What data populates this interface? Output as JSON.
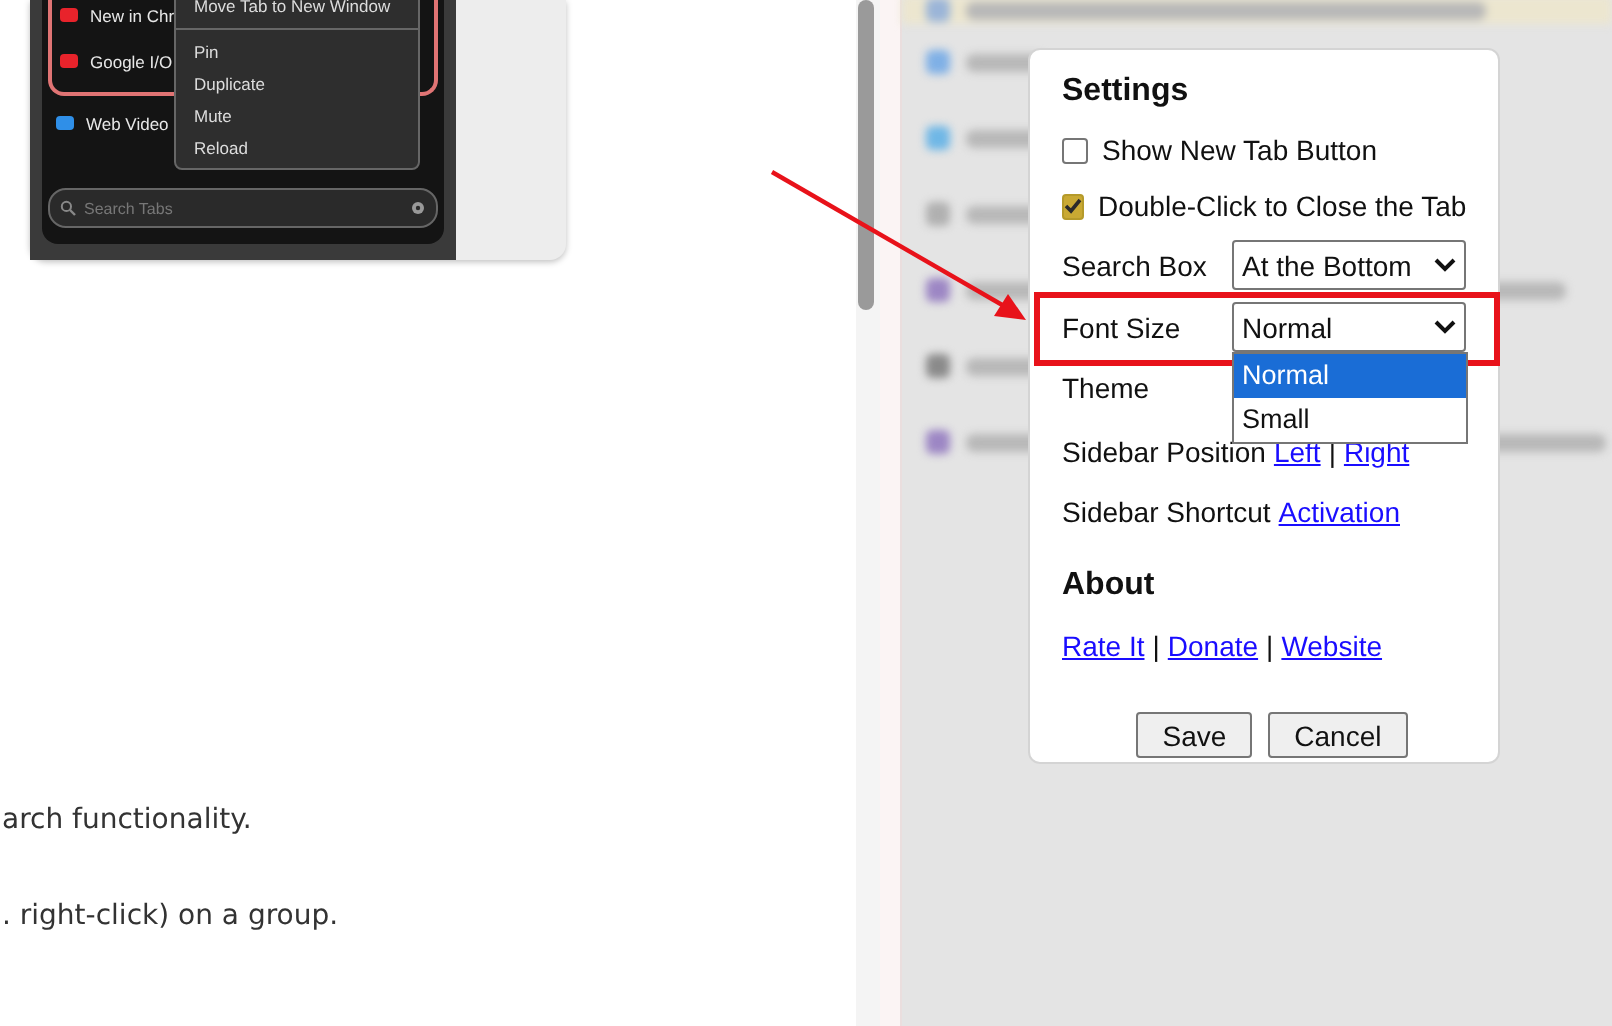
{
  "article": {
    "preview": {
      "tabs": [
        {
          "title": "New in Chr",
          "color": "#e8232b",
          "grouped": true
        },
        {
          "title": "Google I/O",
          "color": "#e8232b",
          "grouped": true
        },
        {
          "title": "Web Video",
          "color": "#2f8fe8",
          "grouped": false
        }
      ],
      "context_menu": [
        "Move Tab to New Window",
        "Pin",
        "Duplicate",
        "Mute",
        "Reload"
      ],
      "search": {
        "placeholder": "Search Tabs"
      }
    },
    "paragraphs": [
      "arch functionality.",
      ". right-click) on a group."
    ]
  },
  "settings": {
    "title": "Settings",
    "rows": [
      {
        "kind": "checkbox",
        "label": "Show New Tab Button",
        "checked": false
      },
      {
        "kind": "checkbox",
        "label": "Double-Click to Close the Tab",
        "checked": true
      },
      {
        "kind": "select",
        "label": "Search Box",
        "value": "At the Bottom"
      },
      {
        "kind": "select",
        "label": "Font Size",
        "value": "Normal",
        "highlighted": true,
        "options": [
          {
            "label": "Normal",
            "selected": true
          },
          {
            "label": "Small",
            "selected": false
          }
        ]
      },
      {
        "kind": "label",
        "label": "Theme"
      },
      {
        "kind": "links",
        "label": "Sidebar Position",
        "links": [
          "Left",
          "Right"
        ],
        "separator": "|"
      },
      {
        "kind": "links",
        "label": "Sidebar Shortcut",
        "links": [
          "Activation"
        ]
      }
    ],
    "about": {
      "title": "About",
      "links": [
        "Rate It",
        "Donate",
        "Website"
      ],
      "separator": "|"
    },
    "buttons": [
      "Save",
      "Cancel"
    ]
  }
}
